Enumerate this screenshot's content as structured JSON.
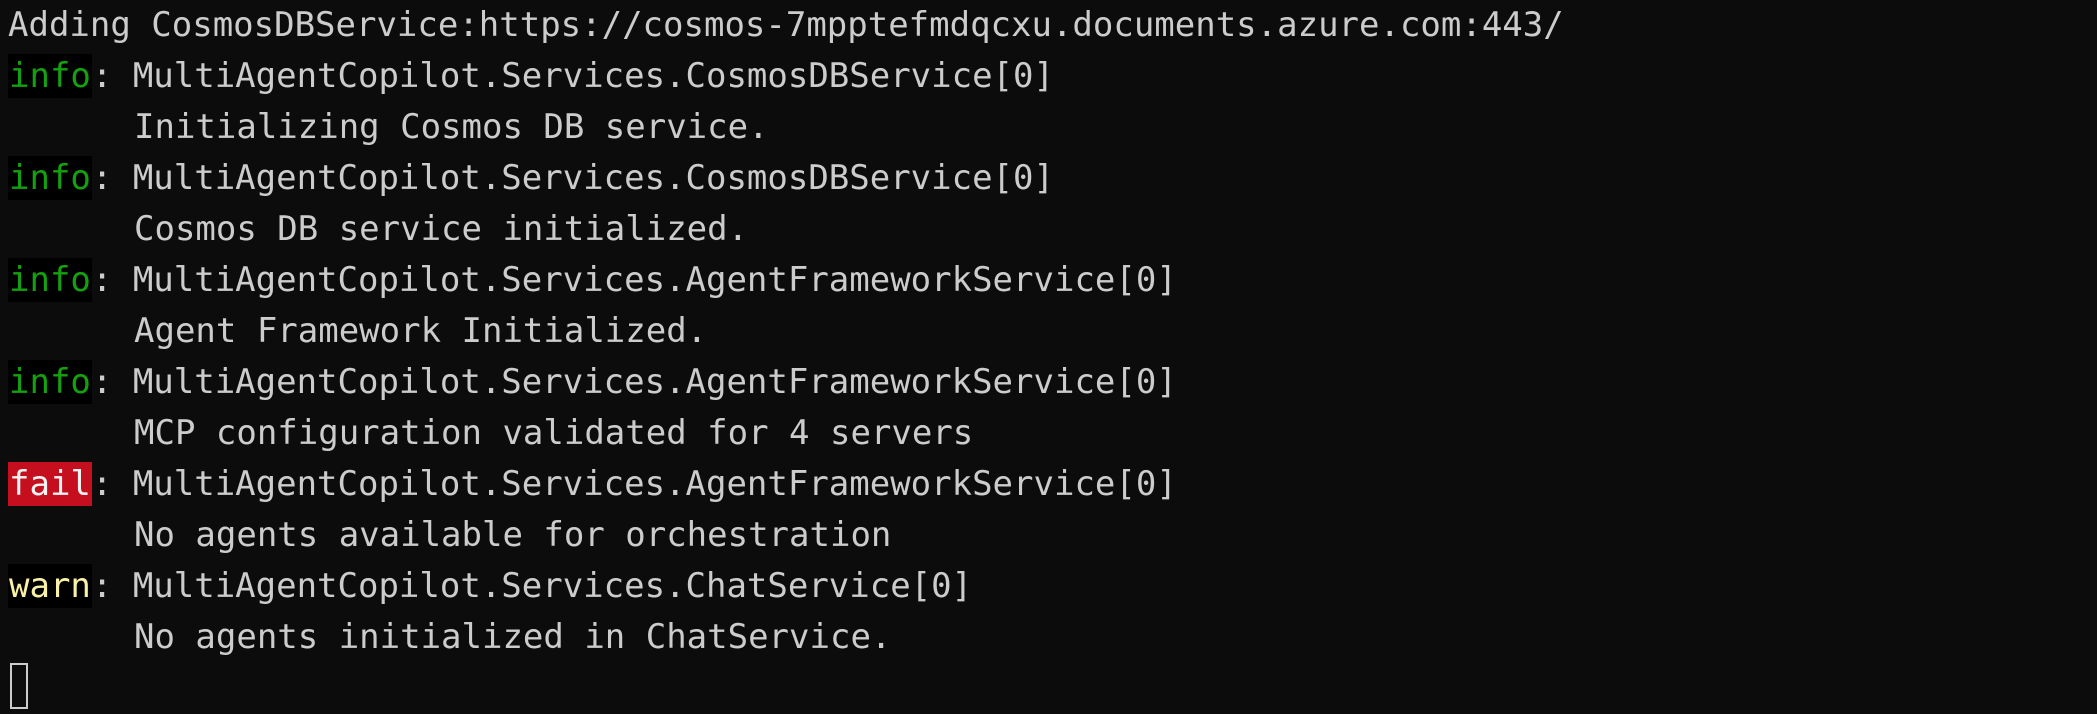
{
  "terminal": {
    "header_line": "Adding CosmosDBService:https://cosmos-7mpptefmdqcxu.documents.azure.com:443/",
    "entries": [
      {
        "level": "info",
        "category": ": MultiAgentCopilot.Services.CosmosDBService[0]",
        "message": "Initializing Cosmos DB service."
      },
      {
        "level": "info",
        "category": ": MultiAgentCopilot.Services.CosmosDBService[0]",
        "message": "Cosmos DB service initialized."
      },
      {
        "level": "info",
        "category": ": MultiAgentCopilot.Services.AgentFrameworkService[0]",
        "message": "Agent Framework Initialized."
      },
      {
        "level": "info",
        "category": ": MultiAgentCopilot.Services.AgentFrameworkService[0]",
        "message": "MCP configuration validated for 4 servers"
      },
      {
        "level": "fail",
        "category": ": MultiAgentCopilot.Services.AgentFrameworkService[0]",
        "message": "No agents available for orchestration"
      },
      {
        "level": "warn",
        "category": ": MultiAgentCopilot.Services.ChatService[0]",
        "message": "No agents initialized in ChatService."
      }
    ]
  },
  "colors": {
    "background": "#0c0c0c",
    "text": "#cccccc",
    "info": "#13a10e",
    "fail_bg": "#c50f1f",
    "warn": "#f9f1a5"
  }
}
